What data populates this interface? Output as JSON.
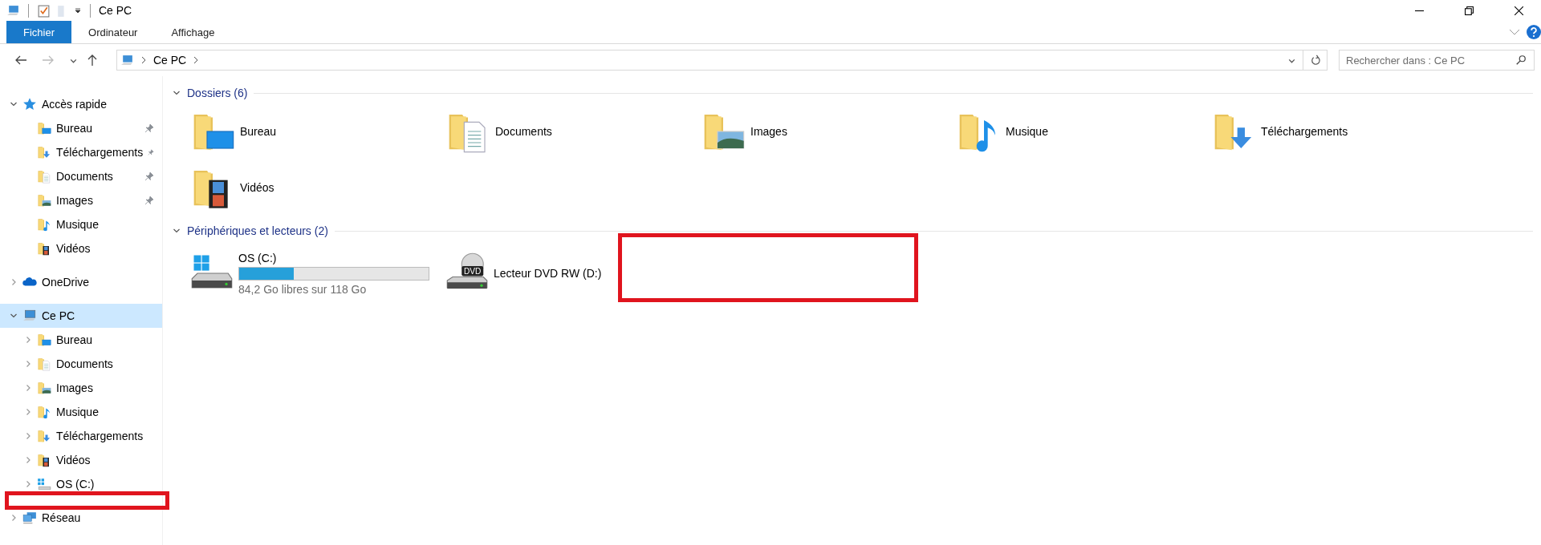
{
  "window": {
    "title": "Ce PC"
  },
  "ribbon": {
    "tabs": [
      {
        "label": "Fichier",
        "selected": true
      },
      {
        "label": "Ordinateur",
        "selected": false
      },
      {
        "label": "Affichage",
        "selected": false
      }
    ]
  },
  "navigation": {
    "back_disabled": false,
    "forward_disabled": true
  },
  "address_bar": {
    "path": [
      "Ce PC"
    ]
  },
  "search": {
    "placeholder": "Rechercher dans : Ce PC"
  },
  "sidebar": {
    "items": [
      {
        "label": "Accès rapide",
        "kind": "star",
        "expanded": true,
        "selected": false,
        "children": [
          {
            "label": "Bureau",
            "kind": "desktop",
            "pinned": true
          },
          {
            "label": "Téléchargements",
            "kind": "downloads",
            "pinned": true
          },
          {
            "label": "Documents",
            "kind": "documents",
            "pinned": true
          },
          {
            "label": "Images",
            "kind": "pictures",
            "pinned": true
          },
          {
            "label": "Musique",
            "kind": "music",
            "pinned": false
          },
          {
            "label": "Vidéos",
            "kind": "videos",
            "pinned": false
          }
        ]
      },
      {
        "label": "OneDrive",
        "kind": "cloud",
        "expanded": false,
        "selected": false
      },
      {
        "label": "Ce PC",
        "kind": "pc",
        "expanded": true,
        "selected": true,
        "children": [
          {
            "label": "Bureau",
            "kind": "desktop",
            "expanded": false
          },
          {
            "label": "Documents",
            "kind": "documents",
            "expanded": false
          },
          {
            "label": "Images",
            "kind": "pictures",
            "expanded": false
          },
          {
            "label": "Musique",
            "kind": "music",
            "expanded": false
          },
          {
            "label": "Téléchargements",
            "kind": "downloads",
            "expanded": false
          },
          {
            "label": "Vidéos",
            "kind": "videos",
            "expanded": false
          },
          {
            "label": "OS (C:)",
            "kind": "drive",
            "expanded": false
          }
        ]
      },
      {
        "label": "Réseau",
        "kind": "network",
        "expanded": false,
        "selected": false
      }
    ]
  },
  "folders": {
    "title": "Dossiers (6)",
    "expanded": true,
    "items": [
      {
        "label": "Bureau",
        "kind": "desktop"
      },
      {
        "label": "Documents",
        "kind": "documents"
      },
      {
        "label": "Images",
        "kind": "pictures"
      },
      {
        "label": "Musique",
        "kind": "music"
      },
      {
        "label": "Téléchargements",
        "kind": "downloads"
      },
      {
        "label": "Vidéos",
        "kind": "videos"
      }
    ]
  },
  "devices": {
    "title": "Périphériques et lecteurs (2)",
    "expanded": true,
    "items": [
      {
        "label": "OS (C:)",
        "kind": "hdd",
        "level": 0.29,
        "free_space": "84,2 Go libres sur 118 Go"
      },
      {
        "label": "Lecteur DVD RW (D:)",
        "kind": "dvd",
        "icon_label": "DVD"
      }
    ]
  },
  "annotations": [
    {
      "kind": "rectangle"
    },
    {
      "kind": "rectangle"
    }
  ]
}
